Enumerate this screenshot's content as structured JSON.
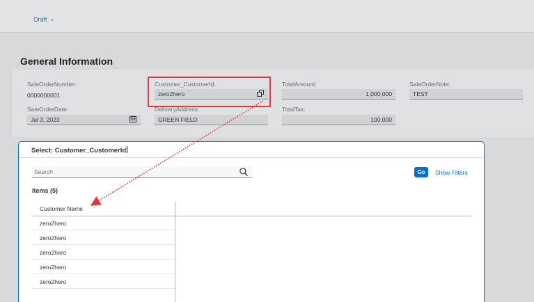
{
  "header": {
    "status_label": "Draft"
  },
  "section": {
    "title": "General Information"
  },
  "form": {
    "sale_order_number": {
      "label": "SaleOrderNumber:",
      "value": "0000000001"
    },
    "sale_order_date": {
      "label": "SaleOrderDate:",
      "value": "Jul 3, 2023"
    },
    "customer_id": {
      "label": "Customer_CustomerId:",
      "value": "zero2hero"
    },
    "delivery_address": {
      "label": "DeliveryAddress:",
      "value": "GREEN FIELD"
    },
    "total_amount": {
      "label": "TotalAmount:",
      "value": "1,000,000"
    },
    "total_tax": {
      "label": "TotalTax:",
      "value": "100,000"
    },
    "sale_order_note": {
      "label": "SaleOrderNote:",
      "value": "TEST"
    }
  },
  "dialog": {
    "title": "Select: Customer_CustomerId",
    "search_placeholder": "Search",
    "go_label": "Go",
    "show_filters_label": "Show Filters",
    "items_title": "Items (5)",
    "column_header": "Customer Name",
    "rows": [
      "zero2hero",
      "zero2hero",
      "zero2hero",
      "zero2hero",
      "zero2hero"
    ]
  },
  "colors": {
    "accent": "#0a6ed1",
    "highlight_box": "#e0393e"
  },
  "icons": {
    "draft_dropdown": "chevron-down-icon",
    "date_picker": "calendar-icon",
    "value_help": "value-help-icon",
    "search": "search-icon"
  }
}
